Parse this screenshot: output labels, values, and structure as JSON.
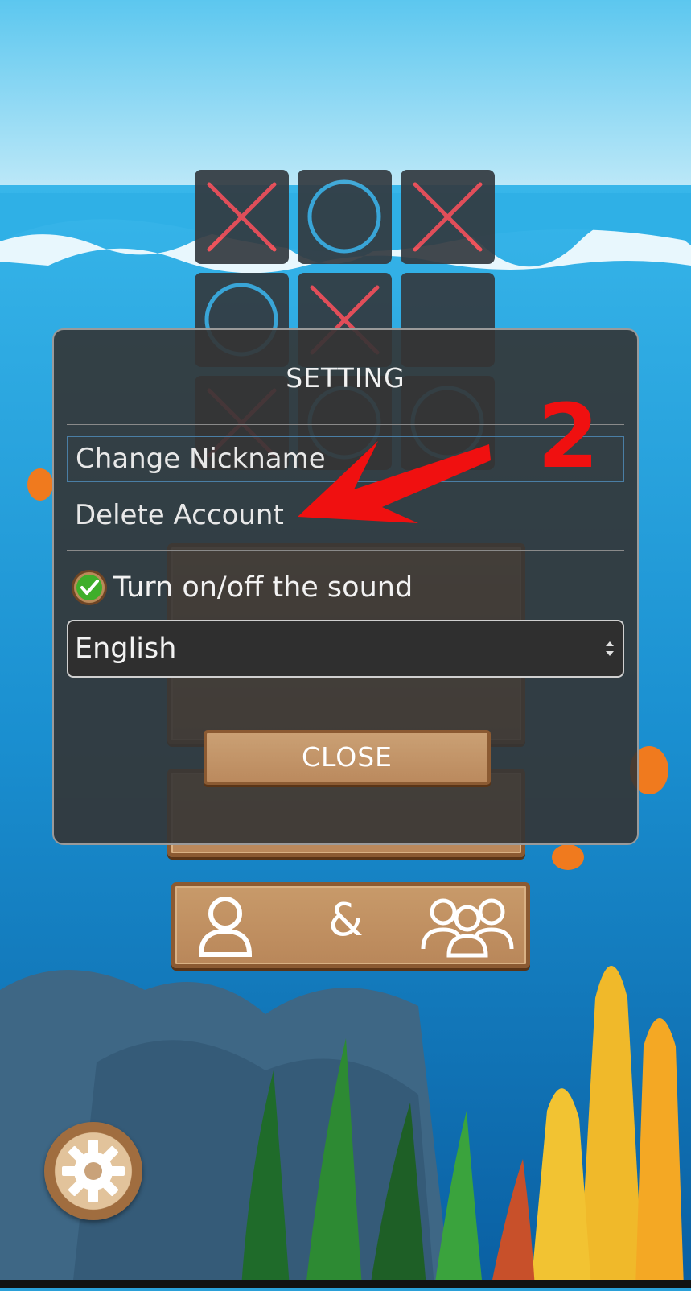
{
  "board": {
    "cells": [
      "X",
      "O",
      "X",
      "O",
      "X",
      "",
      "X",
      "O",
      "O"
    ]
  },
  "mode_buttons": {
    "ampersand": "&"
  },
  "modal": {
    "title": "SETTING",
    "items": [
      {
        "label": "Change Nickname"
      },
      {
        "label": "Delete Account"
      }
    ],
    "sound_label": "Turn on/off the sound",
    "sound_enabled": true,
    "language_selected": "English",
    "close_label": "CLOSE"
  },
  "annotation": {
    "number": "2"
  },
  "colors": {
    "x_mark": "#f0464e",
    "o_mark": "#3aa5d6",
    "annotation": "#f01010"
  }
}
